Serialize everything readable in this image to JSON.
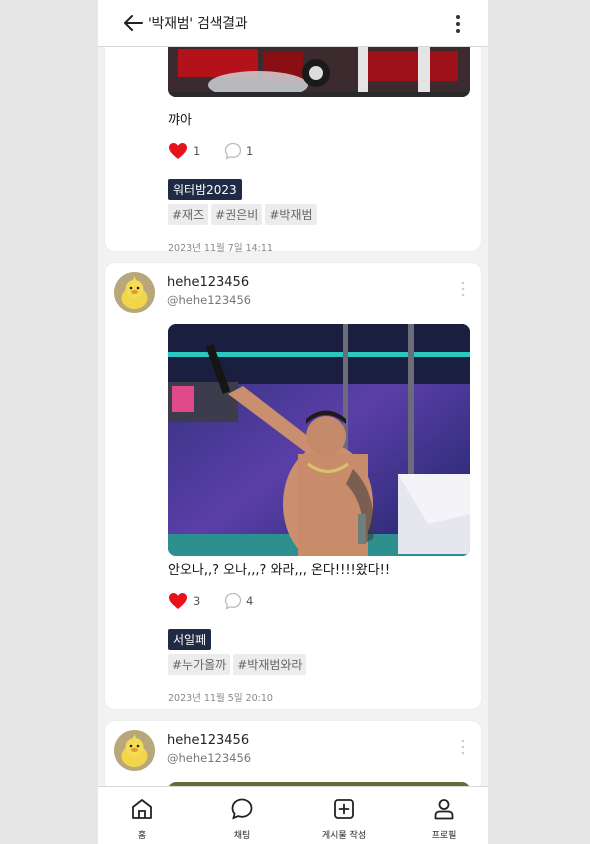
{
  "header": {
    "title": "'박재범' 검색결과"
  },
  "posts": [
    {
      "text": "꺄아",
      "likes": "1",
      "comments": "1",
      "category": "워터밤2023",
      "tags": [
        "#재즈",
        "#권은비",
        "#박재범"
      ],
      "date": "2023년 11월 7일 14:11"
    },
    {
      "author": "hehe123456",
      "handle": "@hehe123456",
      "text": "안오나,,? 오나,,,? 와라,,, 온다!!!!왔다!!",
      "likes": "3",
      "comments": "4",
      "category": "서일페",
      "tags": [
        "#누가올까",
        "#박재범와라"
      ],
      "date": "2023년 11월 5일 20:10"
    },
    {
      "author": "hehe123456",
      "handle": "@hehe123456"
    }
  ],
  "nav": {
    "home": "홈",
    "chat": "채팅",
    "write": "게시물 작성",
    "profile": "프로필"
  },
  "colors": {
    "like": "#e8121b",
    "category_bg": "#1f2a44",
    "tag_bg": "#ececec"
  }
}
